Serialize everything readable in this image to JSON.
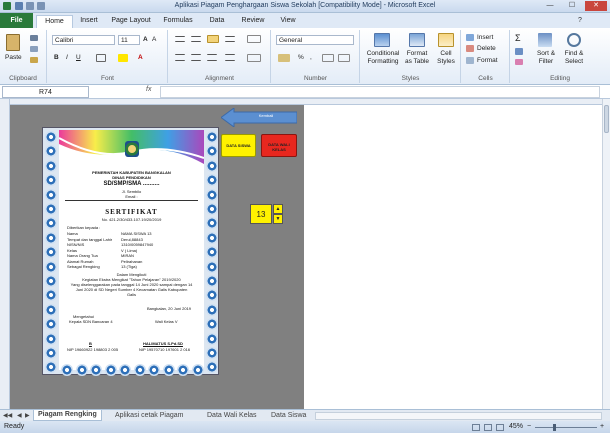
{
  "window": {
    "title": "Aplikasi Piagam Penghargaan Siswa Sekolah  [Compatibility Mode]  -  Microsoft Excel"
  },
  "tabs": [
    "File",
    "Home",
    "Insert",
    "Page Layout",
    "Formulas",
    "Data",
    "Review",
    "View"
  ],
  "ribbon": {
    "clipboard": {
      "paste": "Paste",
      "label": "Clipboard"
    },
    "font": {
      "name": "Calibri",
      "size": "11",
      "label": "Font"
    },
    "alignment": {
      "label": "Alignment"
    },
    "number": {
      "format": "General",
      "pct": "%",
      "label": "Number"
    },
    "styles": {
      "cond": "Conditional",
      "cond2": "Formatting",
      "fmt": "Format",
      "fmt2": "as Table",
      "cell": "Cell",
      "cell2": "Styles",
      "label": "Styles"
    },
    "cells": {
      "insert": "Insert",
      "delete": "Delete",
      "format": "Format",
      "label": "Cells"
    },
    "editing": {
      "sort": "Sort &",
      "sort2": "Filter",
      "find": "Find &",
      "find2": "Select",
      "label": "Editing"
    }
  },
  "formula": {
    "namebox": "R74",
    "fx": "fx"
  },
  "sheet": {
    "kembali": "Kembali",
    "data_siswa": "DATA SISWA",
    "data_wali": "DATA WALI KELAS",
    "spinner_value": "13"
  },
  "certificate": {
    "gov": "PEMERINTAH KABUPATEN BANGKALAN",
    "dept": "DINAS PENDIDIKAN",
    "school": "SD/SMP/SMA ..........",
    "addr": "Jl. Sembilo",
    "email": "Email :",
    "heading": "SERTIFIKAT",
    "number": "No. 421.2/30/433.107.19/20/2019",
    "given": "Diberikan kepada :",
    "fields": [
      {
        "k": "Nama",
        "v": "NAMA SISWA 13"
      },
      {
        "k": "Tempat dan tanggal Lahir",
        "v": "Derul,88843"
      },
      {
        "k": "NISN/NIS",
        "v": "1310/0059847940"
      },
      {
        "k": "Kelas",
        "v": "V ( Lima)"
      },
      {
        "k": "Nama Orang Tua",
        "v": "MIRAN"
      },
      {
        "k": "Alamat Rumah",
        "v": "Pelirahanan"
      },
      {
        "k": "Sebagai Rengking",
        "v": "13 (Tiga)"
      }
    ],
    "body1": "Dalam Mengikuti",
    "body2": "Kegiatan Ekstra Mengikat \"Tahun Pelajaran\" 2019/2020",
    "body3": "Yang diselenggarakan pada tanggal 14 Juni 2020 sampai dengan 14",
    "body4": "Juni 2020          di SD Negeri Sumber 4 Kecamatan Galis Kabupaten",
    "body5": "Galis",
    "place_date": "Bangkalan, 20 Juni 2019",
    "know": "Mengetahui",
    "head_title": "Kepala SDN Bancaran 4",
    "wali_title": "Wali Kelas V",
    "head_name": "B",
    "wali_name": "HALIMATUS S.Pd.SD",
    "head_nip": "NIP 19660922 198803 2 005",
    "wali_nip": "NIP 19570710 197601 2 016"
  },
  "sheet_tabs": [
    "Piagam Rengking",
    "Aplikasi cetak Piagam",
    "Data Wali Kelas",
    "Data Siswa"
  ],
  "status": {
    "ready": "Ready",
    "zoom": "45%"
  }
}
